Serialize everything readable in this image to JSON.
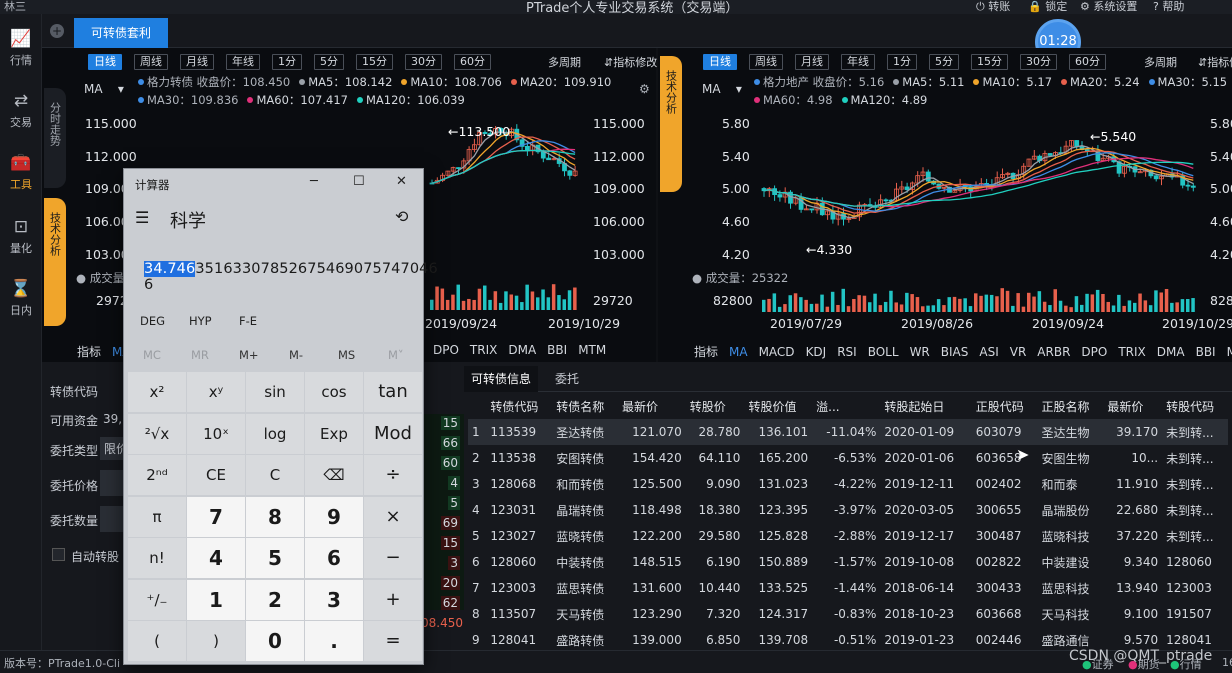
{
  "titlebar": {
    "user": "林三",
    "app_title": "PTrade个人专业交易系统（交易端）",
    "actions": [
      "转账",
      "锁定",
      "系统设置",
      "帮助"
    ]
  },
  "sidebar": {
    "items": [
      {
        "label": "行情",
        "icon": "chart-icon"
      },
      {
        "label": "交易",
        "icon": "exchange-icon"
      },
      {
        "label": "工具",
        "icon": "toolbox-icon"
      },
      {
        "label": "量化",
        "icon": "quant-icon"
      },
      {
        "label": "日内",
        "icon": "intraday-icon"
      }
    ]
  },
  "tabs": {
    "active": "可转债套利",
    "add": "+"
  },
  "clock": {
    "time": "01:28"
  },
  "left_chart": {
    "periods": [
      "日线",
      "周线",
      "月线",
      "年线",
      "1分",
      "5分",
      "15分",
      "30分",
      "60分"
    ],
    "multi": "多周期",
    "edit_ind": "指标修改",
    "ma_select": "MA",
    "vtabs": [
      "分时走势",
      "技术分析"
    ],
    "legend_line1": [
      {
        "text": "格力转债  收盘价：108.450",
        "color": "#3e8de6"
      },
      {
        "text": "MA5：108.142",
        "color": "#9aa0a8"
      },
      {
        "text": "MA10：108.706",
        "color": "#f0a52b"
      },
      {
        "text": "MA20：109.910",
        "color": "#e8604c"
      }
    ],
    "legend_line2": [
      {
        "text": "MA30：109.836",
        "color": "#3e8de6"
      },
      {
        "text": "MA60：107.417",
        "color": "#e0307a"
      },
      {
        "text": "MA120：106.039",
        "color": "#20d0c0"
      }
    ],
    "y_labels": [
      "115.000",
      "112.000",
      "109.000",
      "106.000",
      "103.000"
    ],
    "peak_label": "←113.500",
    "volume_label": "成交量",
    "vol_left": "2972",
    "vol_right": "29720",
    "dates": [
      "2019/09/24",
      "2019/10/29"
    ],
    "indicators": [
      "指标",
      "MA",
      "DPO",
      "TRIX",
      "DMA",
      "BBI",
      "MTM"
    ]
  },
  "right_chart": {
    "periods": [
      "日线",
      "周线",
      "月线",
      "年线",
      "1分",
      "5分",
      "15分",
      "30分",
      "60分"
    ],
    "multi": "多周期",
    "edit_ind": "指标修改",
    "ma_select": "MA",
    "vtab": "技术分析",
    "legend_line1": [
      {
        "text": "格力地产  收盘价：5.16",
        "color": "#3e8de6"
      },
      {
        "text": "MA5：5.11",
        "color": "#9aa0a8"
      },
      {
        "text": "MA10：5.17",
        "color": "#f0a52b"
      },
      {
        "text": "MA20：5.24",
        "color": "#e8604c"
      },
      {
        "text": "MA30：5.15",
        "color": "#3e8de6"
      }
    ],
    "legend_line2": [
      {
        "text": "MA60：4.98",
        "color": "#e0307a"
      },
      {
        "text": "MA120：4.89",
        "color": "#20d0c0"
      }
    ],
    "y_labels": [
      "5.80",
      "5.40",
      "5.00",
      "4.60",
      "4.20"
    ],
    "y_labels_right": [
      "5.80",
      "5.40",
      "5.00",
      "4.60",
      "4.20"
    ],
    "peak_label": "←5.540",
    "low_label": "←4.330",
    "volume_label": "成交量：25322",
    "vol_left": "82800",
    "vol_right": "828",
    "dates": [
      "2019/07/29",
      "2019/08/26",
      "2019/09/24",
      "2019/10/29"
    ],
    "indicators": [
      "指标",
      "MA",
      "MACD",
      "KDJ",
      "RSI",
      "BOLL",
      "WR",
      "BIAS",
      "ASI",
      "VR",
      "ARBR",
      "DPO",
      "TRIX",
      "DMA",
      "BBI",
      "MTM"
    ]
  },
  "order_form": {
    "labels": [
      "转债代码",
      "可用资金",
      "委托类型",
      "委托价格",
      "委托数量"
    ],
    "funds": "39,8",
    "type_value": "限价",
    "auto_convert": "自动转股",
    "side_numbers": [
      "15",
      "66",
      "60",
      "4",
      "5",
      "69",
      "15",
      "3",
      "20",
      "62"
    ],
    "side_price": "08.450"
  },
  "bond_panel": {
    "tabs": [
      "可转债信息",
      "委托"
    ],
    "columns": [
      "转债代码",
      "转债名称",
      "最新价",
      "转股价",
      "转股价值",
      "溢...",
      "转股起始日",
      "正股代码",
      "正股名称",
      "最新价",
      "转股代码"
    ],
    "rows": [
      [
        "1",
        "113539",
        "圣达转债",
        "121.070",
        "28.780",
        "136.101",
        "-11.04%",
        "2020-01-09",
        "603079",
        "圣达生物",
        "39.170",
        "未到转..."
      ],
      [
        "2",
        "113538",
        "安图转债",
        "154.420",
        "64.110",
        "165.200",
        "-6.53%",
        "2020-01-06",
        "603658",
        "安图生物",
        "10...",
        "未到转..."
      ],
      [
        "3",
        "128068",
        "和而转债",
        "125.500",
        "9.090",
        "131.023",
        "-4.22%",
        "2019-12-11",
        "002402",
        "和而泰",
        "11.910",
        "未到转..."
      ],
      [
        "4",
        "123031",
        "晶瑞转债",
        "118.498",
        "18.380",
        "123.395",
        "-3.97%",
        "2020-03-05",
        "300655",
        "晶瑞股份",
        "22.680",
        "未到转..."
      ],
      [
        "5",
        "123027",
        "蓝晓转债",
        "122.200",
        "29.580",
        "125.828",
        "-2.88%",
        "2019-12-17",
        "300487",
        "蓝晓科技",
        "37.220",
        "未到转..."
      ],
      [
        "6",
        "128060",
        "中装转债",
        "148.515",
        "6.190",
        "150.889",
        "-1.57%",
        "2019-10-08",
        "002822",
        "中装建设",
        "9.340",
        "128060"
      ],
      [
        "7",
        "123003",
        "蓝思转债",
        "131.600",
        "10.440",
        "133.525",
        "-1.44%",
        "2018-06-14",
        "300433",
        "蓝思科技",
        "13.940",
        "123003"
      ],
      [
        "8",
        "113507",
        "天马转债",
        "123.290",
        "7.320",
        "124.317",
        "-0.83%",
        "2018-10-23",
        "603668",
        "天马科技",
        "9.100",
        "191507"
      ],
      [
        "9",
        "128041",
        "盛路转债",
        "139.000",
        "6.850",
        "139.708",
        "-0.51%",
        "2019-01-23",
        "002446",
        "盛路通信",
        "9.570",
        "128041"
      ]
    ]
  },
  "calculator": {
    "title": "计算器",
    "mode": "科学",
    "display_selected": "34.746",
    "display_rest": "35163307852675469075747046​6",
    "row1": [
      "DEG",
      "HYP",
      "F-E"
    ],
    "memory": [
      "MC",
      "MR",
      "M+",
      "M-",
      "MS",
      "M˅"
    ],
    "keys": [
      [
        "x²",
        "xʸ",
        "sin",
        "cos",
        "tan"
      ],
      [
        "²√x",
        "10ˣ",
        "log",
        "Exp",
        "Mod"
      ],
      [
        "2ⁿᵈ",
        "CE",
        "C",
        "⌫",
        "÷"
      ],
      [
        "π",
        "7",
        "8",
        "9",
        "×"
      ],
      [
        "n!",
        "4",
        "5",
        "6",
        "−"
      ],
      [
        "⁺∕₋",
        "1",
        "2",
        "3",
        "+"
      ],
      [
        "(",
        ")",
        "0",
        ".",
        "="
      ]
    ]
  },
  "statusbar": {
    "version": "版本号：PTrade1.0-Cli",
    "watermark": "CSDN @QMT_ptrade",
    "legend": [
      "证券",
      "期货",
      "行情"
    ],
    "right_num": "16"
  }
}
